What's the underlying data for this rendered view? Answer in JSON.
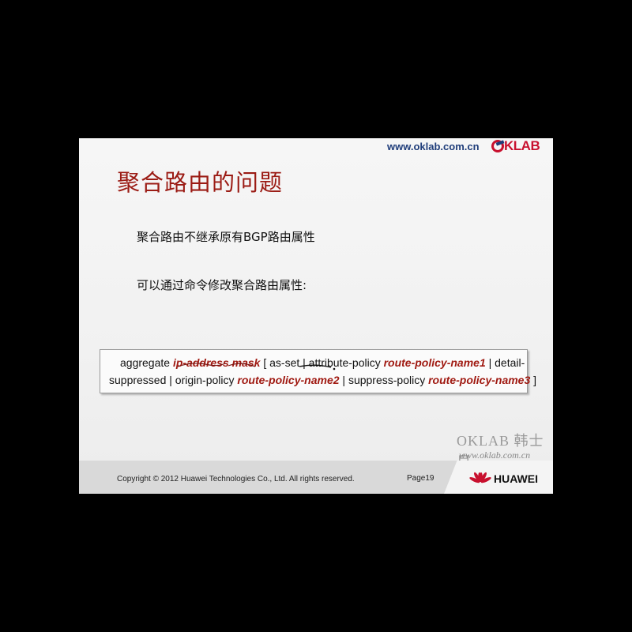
{
  "header": {
    "site_url": "www.oklab.com.cn",
    "logo_text": "KLAB"
  },
  "slide": {
    "title": "聚合路由的问题",
    "bullets": [
      "聚合路由不继承原有BGP路由属性",
      "可以通过命令修改聚合路由属性:"
    ]
  },
  "command": {
    "line1": [
      {
        "t": "aggregate ",
        "arg": false
      },
      {
        "t": "ip-address mask",
        "arg": true
      },
      {
        "t": " [ as-set | attribute-policy ",
        "arg": false
      },
      {
        "t": "route-policy-name1",
        "arg": true
      },
      {
        "t": " | detail-",
        "arg": false
      }
    ],
    "line2": [
      {
        "t": "suppressed | origin-policy ",
        "arg": false
      },
      {
        "t": "route-policy-name2",
        "arg": true
      },
      {
        "t": " | suppress-policy ",
        "arg": false
      },
      {
        "t": "route-policy-name3",
        "arg": true
      },
      {
        "t": " ]",
        "arg": false
      }
    ]
  },
  "watermark": {
    "line1": "OKLAB 韩士良",
    "line2": "www.oklab.com.cn"
  },
  "footer": {
    "copyright": "Copyright © 2012 Huawei Technologies Co., Ltd. All rights reserved.",
    "page": "Page19",
    "brand": "HUAWEI"
  },
  "colors": {
    "title": "#9b1b14",
    "argument": "#a01a12",
    "brand_red": "#c8102e",
    "url_blue": "#1f3d7a"
  }
}
